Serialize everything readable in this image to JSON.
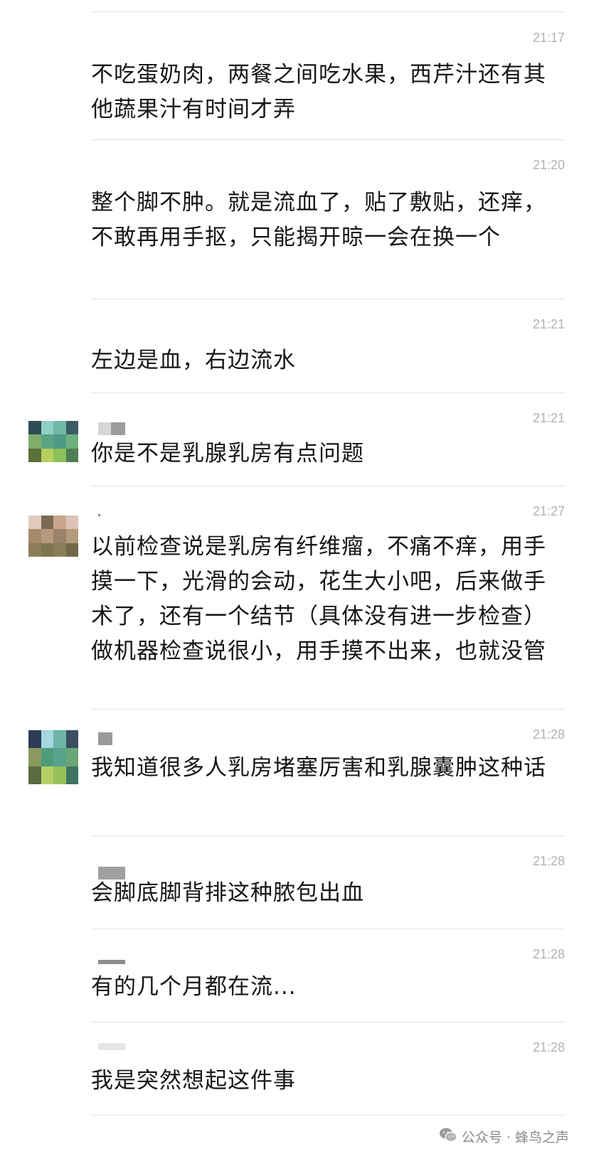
{
  "messages": [
    {
      "time": "21:17",
      "text": "不吃蛋奶肉，两餐之间吃水果，西芹汁还有其他蔬果汁有时间才弄"
    },
    {
      "time": "21:20",
      "text": "整个脚不肿。就是流血了，贴了敷贴，还痒，不敢再用手抠，只能揭开晾一会在换一个"
    },
    {
      "time": "21:21",
      "text": "左边是血，右边流水"
    },
    {
      "time": "21:21",
      "text": "你是不是乳腺乳房有点问题"
    },
    {
      "time": "21:27",
      "text": "以前检查说是乳房有纤维瘤，不痛不痒，用手摸一下，光滑的会动，花生大小吧，后来做手术了，还有一个结节（具体没有进一步检查）做机器检查说很小，用手摸不出来，也就没管"
    },
    {
      "time": "21:28",
      "text": "我知道很多人乳房堵塞厉害和乳腺囊肿这种话"
    },
    {
      "time": "21:28",
      "text": "会脚底脚背排这种脓包出血"
    },
    {
      "time": "21:28",
      "text": "有的几个月都在流..."
    },
    {
      "time": "21:28",
      "text": "我是突然想起这件事"
    }
  ],
  "watermark": {
    "text": "公众号 · 蜂鸟之声",
    "icon": "wechat-icon"
  },
  "colors": {
    "text": "#161616",
    "time": "#b2b2b2",
    "divider": "#e3e3e3"
  }
}
